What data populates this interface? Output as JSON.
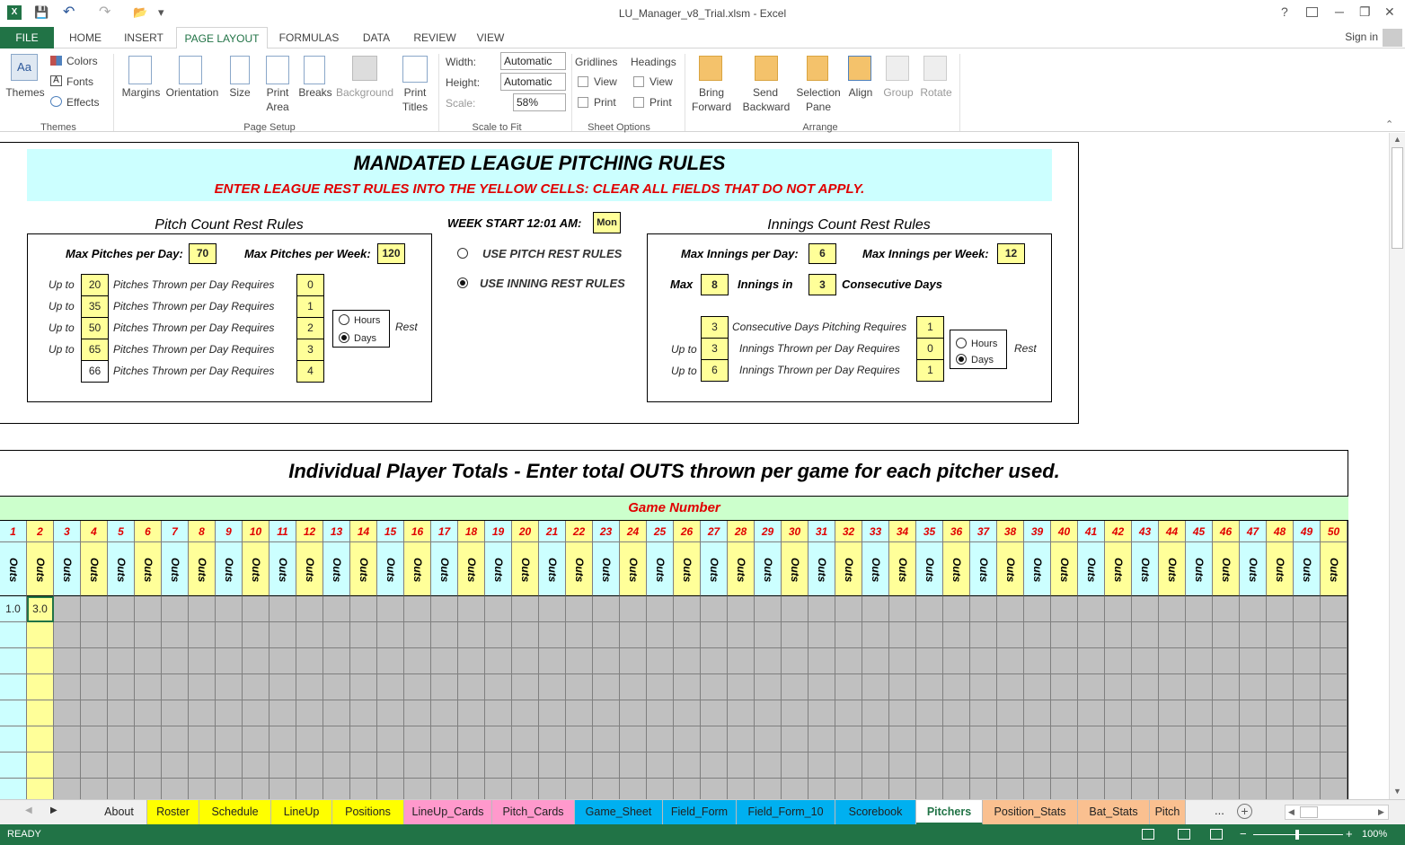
{
  "window": {
    "title": "LU_Manager_v8_Trial.xlsm - Excel",
    "help": "?",
    "minimize": "─",
    "restore": "❐",
    "close": "✕"
  },
  "qat": {
    "save": "💾",
    "undo": "↶",
    "redo": "↷",
    "open": "📂",
    "more": "▾"
  },
  "ribbon_tabs": [
    "FILE",
    "HOME",
    "INSERT",
    "PAGE LAYOUT",
    "FORMULAS",
    "DATA",
    "REVIEW",
    "VIEW"
  ],
  "signin": "Sign in",
  "ribbon": {
    "themes": {
      "themes": "Themes",
      "colors": "Colors",
      "fonts": "Fonts",
      "effects": "Effects",
      "group": "Themes"
    },
    "page_setup": {
      "margins": "Margins",
      "orientation": "Orientation",
      "size": "Size",
      "print_area_1": "Print",
      "print_area_2": "Area",
      "breaks": "Breaks",
      "background": "Background",
      "print_titles_1": "Print",
      "print_titles_2": "Titles",
      "group": "Page Setup"
    },
    "scale": {
      "width_label": "Width:",
      "width_value": "Automatic",
      "height_label": "Height:",
      "height_value": "Automatic",
      "scale_label": "Scale:",
      "scale_value": "58%",
      "group": "Scale to Fit"
    },
    "sheet_options": {
      "gridlines": "Gridlines",
      "headings": "Headings",
      "view": "View",
      "print": "Print",
      "group": "Sheet Options"
    },
    "arrange": {
      "bring_1": "Bring",
      "bring_2": "Forward",
      "send_1": "Send",
      "send_2": "Backward",
      "selection_1": "Selection",
      "selection_2": "Pane",
      "align": "Align",
      "group_btn": "Group",
      "rotate": "Rotate",
      "group": "Arrange"
    }
  },
  "rules": {
    "title": "MANDATED LEAGUE PITCHING RULES",
    "subtitle": "ENTER LEAGUE REST RULES INTO THE YELLOW CELLS:  CLEAR ALL FIELDS THAT DO NOT APPLY.",
    "pitch": {
      "heading": "Pitch Count Rest Rules",
      "max_day_label": "Max Pitches per Day:",
      "max_day": "70",
      "max_week_label": "Max Pitches per Week:",
      "max_week": "120",
      "rows": [
        {
          "prefix": "Up to",
          "pitches": "20",
          "text": "Pitches Thrown per Day Requires",
          "rest": "0"
        },
        {
          "prefix": "Up to",
          "pitches": "35",
          "text": "Pitches Thrown per Day Requires",
          "rest": "1"
        },
        {
          "prefix": "Up to",
          "pitches": "50",
          "text": "Pitches Thrown per Day Requires",
          "rest": "2"
        },
        {
          "prefix": "Up to",
          "pitches": "65",
          "text": "Pitches Thrown per Day Requires",
          "rest": "3"
        },
        {
          "prefix": "",
          "pitches": "66",
          "text": "Pitches Thrown per Day Requires",
          "rest": "4"
        }
      ],
      "hours": "Hours",
      "days": "Days",
      "rest": "Rest"
    },
    "week_start_label": "WEEK START 12:01 AM:",
    "week_start": "Mon",
    "opt_pitch": "USE PITCH REST RULES",
    "opt_inning": "USE INNING REST RULES",
    "innings": {
      "heading": "Innings Count Rest Rules",
      "max_day_label": "Max Innings per Day:",
      "max_day": "6",
      "max_week_label": "Max Innings per Week:",
      "max_week": "12",
      "max_label": "Max",
      "max": "8",
      "innings_in": "Innings in",
      "consec": "3",
      "consec_label": "Consecutive Days",
      "rows": [
        {
          "prefix": "",
          "val": "3",
          "text": "Consecutive Days Pitching Requires",
          "rest": "1"
        },
        {
          "prefix": "Up to",
          "val": "3",
          "text": "Innings Thrown per Day Requires",
          "rest": "0"
        },
        {
          "prefix": "Up to",
          "val": "6",
          "text": "Innings Thrown per Day Requires",
          "rest": "1"
        }
      ],
      "hours": "Hours",
      "days": "Days",
      "rest": "Rest"
    }
  },
  "totals": {
    "title": "Individual Player Totals - Enter total OUTS thrown per game for each pitcher used.",
    "game_number": "Game Number",
    "outs": "Outs",
    "games": [
      "1",
      "2",
      "3",
      "4",
      "5",
      "6",
      "7",
      "8",
      "9",
      "10",
      "11",
      "12",
      "13",
      "14",
      "15",
      "16",
      "17",
      "18",
      "19",
      "20",
      "21",
      "22",
      "23",
      "24",
      "25",
      "26",
      "27",
      "28",
      "29",
      "30",
      "31",
      "32",
      "33",
      "34",
      "35",
      "36",
      "37",
      "38",
      "39",
      "40",
      "41",
      "42",
      "43",
      "44",
      "45",
      "46",
      "47",
      "48",
      "49",
      "50"
    ],
    "first_row": [
      "1.0",
      "3.0"
    ]
  },
  "sheet_tabs": [
    {
      "name": "About",
      "color": "#f0f0f0"
    },
    {
      "name": "Roster",
      "color": "#ffff00"
    },
    {
      "name": "Schedule",
      "color": "#ffff00"
    },
    {
      "name": "LineUp",
      "color": "#ffff00"
    },
    {
      "name": "Positions",
      "color": "#ffff00"
    },
    {
      "name": "LineUp_Cards",
      "color": "#ff99cc"
    },
    {
      "name": "Pitch_Cards",
      "color": "#ff99cc"
    },
    {
      "name": "Game_Sheet",
      "color": "#00b0f0"
    },
    {
      "name": "Field_Form",
      "color": "#00b0f0"
    },
    {
      "name": "Field_Form_10",
      "color": "#00b0f0"
    },
    {
      "name": "Scorebook",
      "color": "#00b0f0"
    },
    {
      "name": "Pitchers",
      "color": "#ffffff"
    },
    {
      "name": "Position_Stats",
      "color": "#fac090"
    },
    {
      "name": "Bat_Stats",
      "color": "#fac090"
    },
    {
      "name": "Pitch",
      "color": "#fac090"
    }
  ],
  "tabs_more": "...",
  "status": {
    "ready": "READY",
    "zoom": "100%"
  }
}
